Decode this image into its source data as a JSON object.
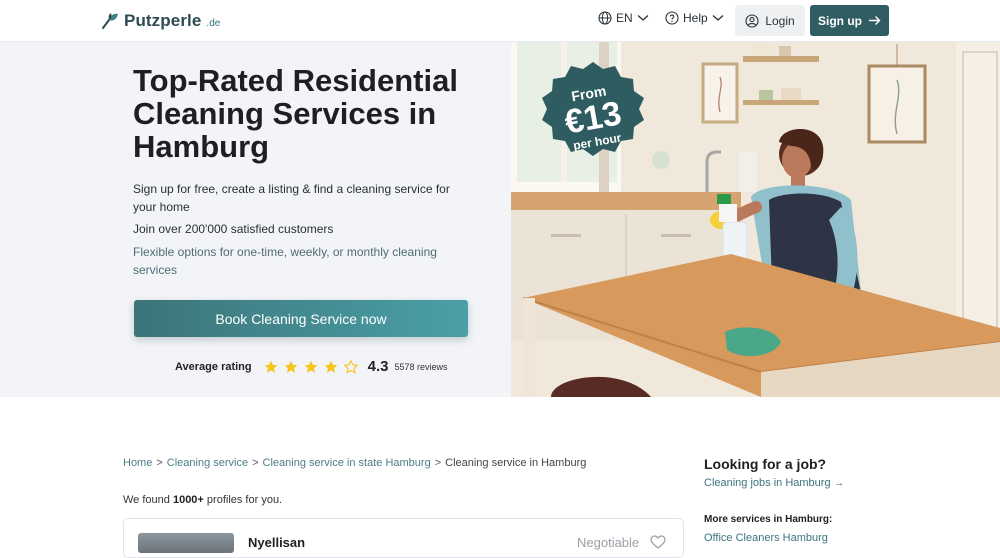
{
  "header": {
    "brand": "Putzperle",
    "brand_tld": ".de",
    "language": "EN",
    "help": "Help",
    "login": "Login",
    "signup": "Sign up"
  },
  "hero": {
    "title": "Top-Rated Residential Cleaning Services in Hamburg",
    "line1": "Sign up for free, create a listing & find a cleaning service for your home",
    "line2": "Join over 200'000 satisfied customers",
    "line3": "Flexible options for one-time, weekly, or monthly cleaning services",
    "cta": "Book Cleaning Service now",
    "rating_label": "Average rating",
    "rating_value": "4.3",
    "rating_stars": 4.3,
    "rating_count": "5578 reviews",
    "badge_from": "From",
    "badge_price": "€13",
    "badge_unit": "per hour"
  },
  "breadcrumb": {
    "items": [
      "Home",
      "Cleaning service",
      "Cleaning service in state Hamburg"
    ],
    "separator": ">",
    "current": "Cleaning service in Hamburg"
  },
  "results": {
    "prefix": "We found ",
    "count": "1000+",
    "suffix": " profiles for you."
  },
  "card": {
    "name": "Nyellisan",
    "price": "Negotiable"
  },
  "sidebar": {
    "job_title": "Looking for a job?",
    "job_link": "Cleaning jobs in Hamburg →",
    "more_title": "More services in Hamburg:",
    "more_link": "Office Cleaners Hamburg"
  },
  "colors": {
    "brand": "#2f5d62",
    "link": "#4c7e86",
    "star": "#f5c518",
    "badge": "#2e5c60"
  }
}
